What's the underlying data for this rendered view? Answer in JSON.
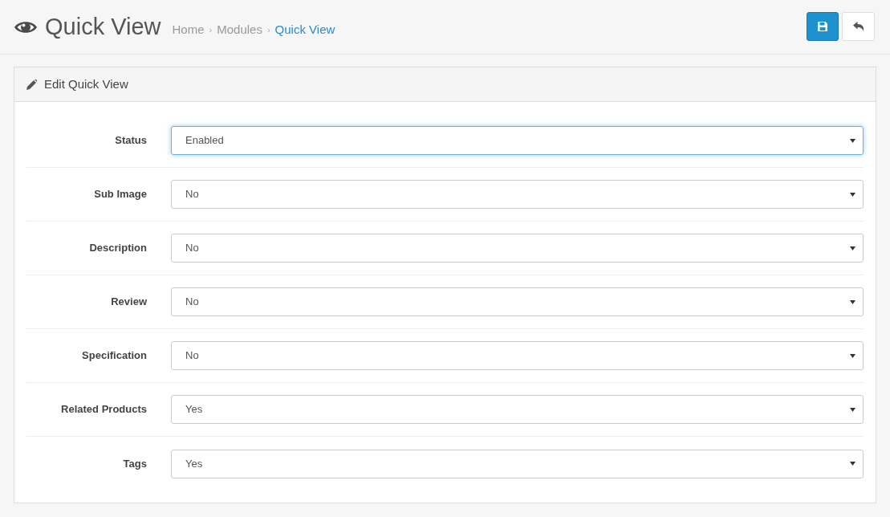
{
  "header": {
    "title": "Quick View",
    "breadcrumb_separator": "›",
    "breadcrumb": [
      {
        "label": "Home",
        "current": false
      },
      {
        "label": "Modules",
        "current": false
      },
      {
        "label": "Quick View",
        "current": true
      }
    ]
  },
  "panel": {
    "title": "Edit Quick View",
    "fields": [
      {
        "label": "Status",
        "value": "Enabled",
        "focused": true
      },
      {
        "label": "Sub Image",
        "value": "No",
        "focused": false
      },
      {
        "label": "Description",
        "value": "No",
        "focused": false
      },
      {
        "label": "Review",
        "value": "No",
        "focused": false
      },
      {
        "label": "Specification",
        "value": "No",
        "focused": false
      },
      {
        "label": "Related Products",
        "value": "Yes",
        "focused": false
      },
      {
        "label": "Tags",
        "value": "Yes",
        "focused": false
      }
    ]
  }
}
